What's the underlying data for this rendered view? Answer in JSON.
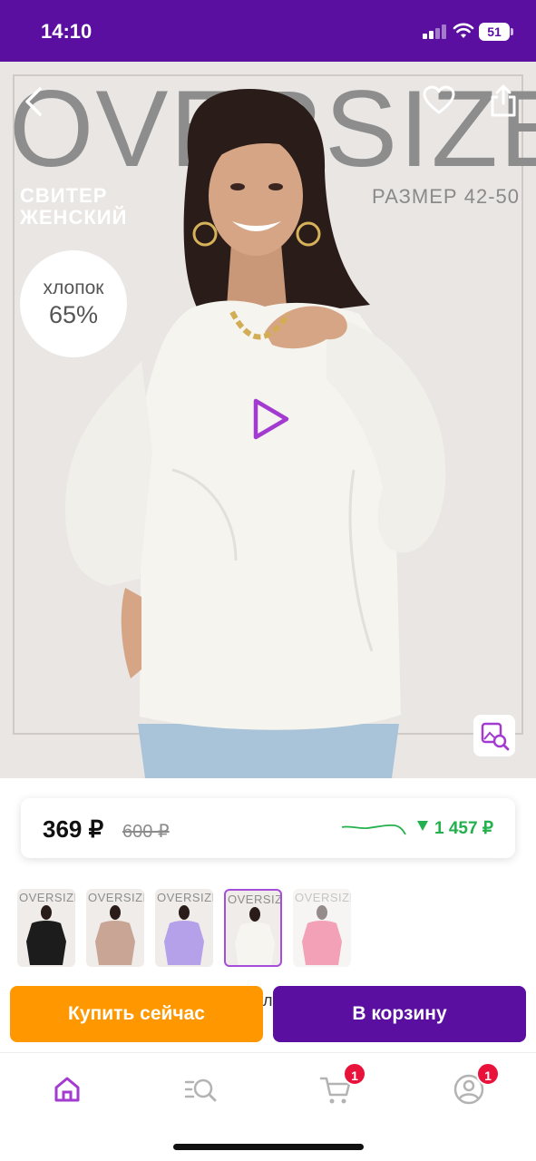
{
  "status_bar": {
    "time": "14:10",
    "battery": "51"
  },
  "banner": {
    "big_title": "OVERSIZE",
    "subtitle": "СВИТЕР ЖЕНСКИЙ",
    "size": "РАЗМЕР 42-50",
    "cotton_label": "хлопок",
    "cotton_value": "65%"
  },
  "price": {
    "current": "369 ₽",
    "old": "600 ₽",
    "previous_high": "1 457 ₽",
    "accent_color": "#23b14d"
  },
  "thumbnails": [
    {
      "title": "OVERSIZE",
      "sweater_color": "#1c1c1c",
      "selected": false
    },
    {
      "title": "OVERSIZE",
      "sweater_color": "#c8a595",
      "selected": false
    },
    {
      "title": "OVERSIZE",
      "sweater_color": "#b5a0ea",
      "selected": false
    },
    {
      "title": "OVERSIZE",
      "sweater_color": "#f7f5f0",
      "selected": true
    },
    {
      "title": "OVERSIZE",
      "sweater_color": "#e8456f",
      "selected": false
    }
  ],
  "actions": {
    "stray_text": "л",
    "buy_now": "Купить сейчас",
    "add_to_cart": "В корзину",
    "buy_color": "#ff9800",
    "cart_color": "#5a0fa0"
  },
  "nav": {
    "items": [
      {
        "icon": "home-icon",
        "active": true
      },
      {
        "icon": "catalog-search-icon",
        "active": false
      },
      {
        "icon": "cart-icon",
        "badge": "1"
      },
      {
        "icon": "profile-icon",
        "badge": "1"
      }
    ],
    "accent_color": "#a33bd1"
  }
}
